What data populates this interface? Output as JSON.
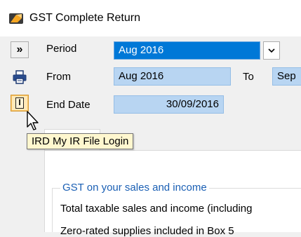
{
  "window": {
    "title": "GST Complete Return",
    "icon": "gst-app-icon"
  },
  "toolbar": {
    "expand_label": "»",
    "print_icon": "printer-icon",
    "ird_icon": "ird-login-icon",
    "ird_icon_glyph": "I"
  },
  "form": {
    "period_label": "Period",
    "period_value": "Aug 2016",
    "period_dropdown_glyph": "⌄",
    "from_label": "From",
    "from_value": "Aug 2016",
    "to_label": "To",
    "to_value": "Sep",
    "end_date_label": "End Date",
    "end_date_value": "30/09/2016"
  },
  "tooltip": {
    "text": "IRD My IR File Login"
  },
  "gst_section": {
    "title": "GST on your sales and income",
    "total_sales_label": "Total taxable sales and income (including",
    "partial_line": "Zero-rated supplies included in Box 5"
  },
  "colors": {
    "selection": "#0078d7",
    "field_bg": "#b8d5f2",
    "tooltip_bg": "#fff7cf",
    "ird_button_bg": "#ffe9b8",
    "group_title": "#1a5fb4"
  }
}
